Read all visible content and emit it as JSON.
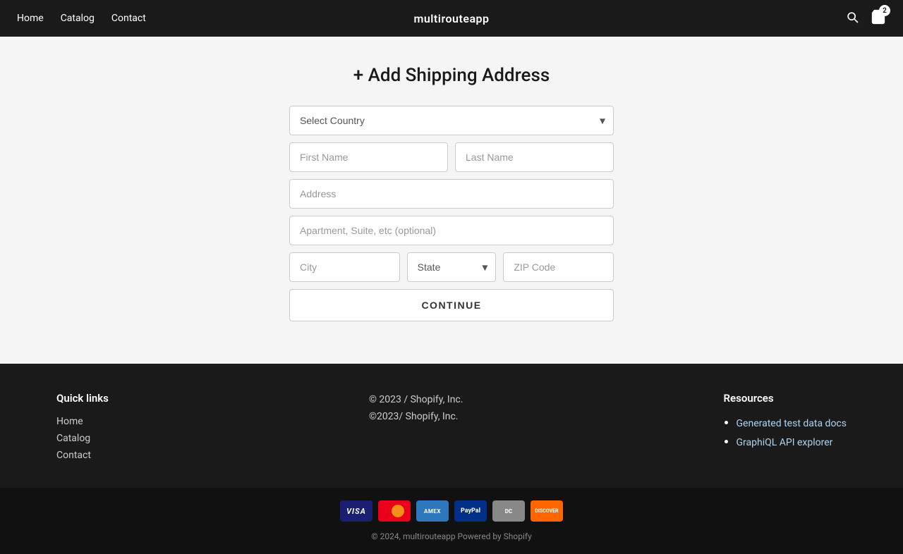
{
  "nav": {
    "brand": "multirouteapp",
    "links": [
      "Home",
      "Catalog",
      "Contact"
    ],
    "cart_count": "2"
  },
  "page": {
    "title": "+ Add Shipping Address"
  },
  "form": {
    "country_placeholder": "Select Country",
    "first_name_placeholder": "First Name",
    "last_name_placeholder": "Last Name",
    "address_placeholder": "Address",
    "apt_placeholder": "Apartment, Suite, etc (optional)",
    "city_placeholder": "City",
    "state_placeholder": "State",
    "zip_placeholder": "ZIP Code",
    "continue_label": "CONTINUE"
  },
  "footer": {
    "quick_links_heading": "Quick links",
    "quick_links": [
      "Home",
      "Catalog",
      "Contact"
    ],
    "copyright_center": "© 2023 / Shopify, Inc.",
    "copyright_center2": "©2023/ Shopify, Inc.",
    "resources_heading": "Resources",
    "resources_links": [
      "Generated test data docs",
      "GraphiQL API explorer"
    ],
    "bottom_copyright": "© 2024, multirouteapp Powered by Shopify"
  },
  "payment_icons": [
    "Visa",
    "Mastercard",
    "Amex",
    "PayPal",
    "Diners",
    "Discover"
  ]
}
